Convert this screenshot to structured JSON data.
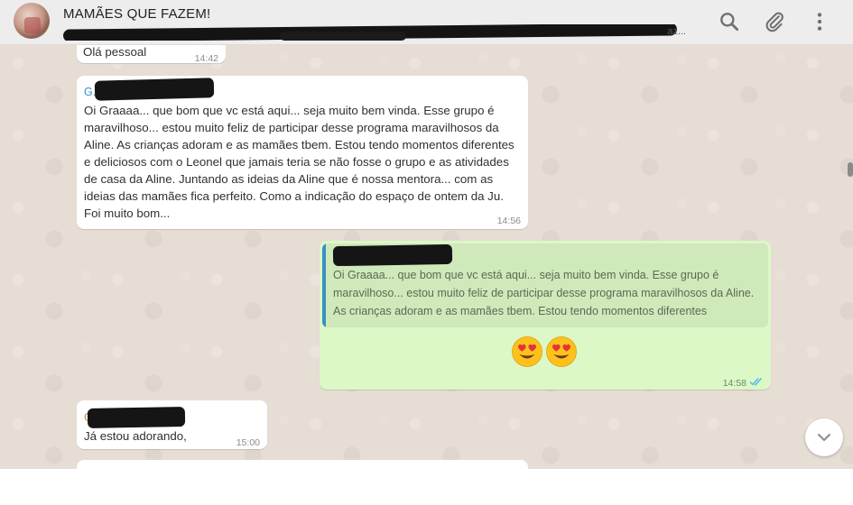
{
  "header": {
    "title": "MAMÃES QUE FAZEM!",
    "members_tail": "az..."
  },
  "icons": {
    "search": "search-icon",
    "attach": "paperclip-icon",
    "menu": "more-vertical-icon",
    "scroll_down": "chevron-down-icon",
    "read_receipt": "double-check-icon"
  },
  "messages": [
    {
      "direction": "incoming",
      "text": "Olá pessoal",
      "time": "14:42"
    },
    {
      "direction": "incoming",
      "sender": "G... da",
      "text": "Oi Graaaa... que bom que vc está aqui... seja muito bem vinda. Esse grupo é maravilhoso... estou muito feliz de participar desse programa maravilhosos da Aline. As crianças adoram e as mamães tbem. Estou tendo momentos diferentes e deliciosos com o Leonel que jamais teria se não fosse o grupo e as atividades de casa da Aline. Juntando as ideias da Aline que é nossa mentora... com as ideias das mamães fica perfeito. Como a indicação do espaço de ontem da Ju. Foi muito bom...",
      "time": "14:56"
    },
    {
      "direction": "outgoing",
      "quote": {
        "sender": "G",
        "text": "Oi Graaaa... que bom que vc está aqui... seja muito bem vinda. Esse grupo é maravilhoso... estou muito feliz de participar desse programa maravilhosos da Aline. As crianças adoram e as mamães tbem. Estou tendo momentos diferentes"
      },
      "emoji": "😍😍",
      "time": "14:58"
    },
    {
      "direction": "incoming",
      "sender": "G",
      "text": "Já estou adorando,",
      "time": "15:00"
    }
  ],
  "colors": {
    "header_bg": "#ededed",
    "chat_bg": "#e6ddd4",
    "incoming_bg": "#ffffff",
    "outgoing_bg": "#dcf8c6",
    "sender_blue": "#3b8fc7",
    "sender_orange": "#d9853b",
    "read_tick": "#4fb6ec"
  }
}
